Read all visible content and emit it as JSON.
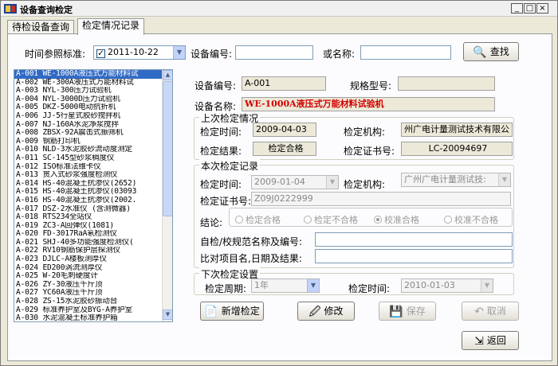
{
  "window": {
    "title": "设备查询检定",
    "min": "_",
    "max": "□",
    "close": "×"
  },
  "tabs": [
    {
      "label": "待检设备查询"
    },
    {
      "label": "检定情况记录"
    }
  ],
  "search": {
    "time_label": "时间参照标准:",
    "date_checked": true,
    "date_value": "2011-10-22",
    "device_no_label": "设备编号:",
    "device_no_value": "",
    "name_label": "或名称:",
    "name_value": "",
    "search_button": "查找"
  },
  "device_list": [
    "A-001 WE-1000A液压式万能材料试",
    "A-002 WE-300A液压式万能材料试",
    "A-003 NYL-300压力试验机",
    "A-004 NYL-3000D压力试验机",
    "A-005 DKZ-5000电动抗折机",
    "A-006 JJ-5行星式胶砂搅拌机",
    "A-007 NJ-160A水泥净浆搅拌",
    "A-008 ZBSX-92A震击式振筛机",
    "A-009 钢筋打印机",
    "A-010 NLD-3水泥胶砂流动度测定",
    "A-011 SC-145型砂浆稠度仪",
    "A-012 ISO标准法维卡仪",
    "A-013 贯入式砂浆强度检测仪",
    "A-014 HS-40混凝土抗渗仪(2652)",
    "A-015 HS-40混凝土抗渗仪(03093",
    "A-016 HS-40混凝土抗渗仪(2002.",
    "A-017 DSZ-2水准仪 (含测微器)",
    "A-018 RTS234全站仪",
    "A-019 ZC3-A回弹仪(1081)",
    "A-020 FD-3017RaA氡检测仪",
    "A-021 SHJ-40多功能强度检测仪(",
    "A-022 RV10钢筋保护层探测仪",
    "A-023 DJLC-A楼板测厚仪",
    "A-024 ED200涡流测厚仪",
    "A-025 W-20毛刺硬度计",
    "A-026 ZY-30液压千斤顶",
    "A-027 YC60A液压千斤顶",
    "A-028 ZS-15水泥胶砂振动台",
    "A-029 标准养护室及BYG-A养护室",
    "A-030 水泥混凝土标准养护箱"
  ],
  "detail": {
    "device_no_label": "设备编号:",
    "device_no_value": "A-001",
    "model_label": "规格型号:",
    "model_value": "",
    "device_name_label": "设备名称:",
    "device_name_value": "WE-1000A液压式万能材料试验机",
    "last": {
      "title": "上次检定情况",
      "date_label": "检定时间:",
      "date_value": "2009-04-03",
      "org_label": "检定机构:",
      "org_value": "州广电计量测试技术有限公",
      "result_label": "检定结果:",
      "result_value": "检定合格",
      "cert_label": "检定证书号:",
      "cert_value": "LC-20094697"
    },
    "current": {
      "title": "本次检定记录",
      "date_label": "检定时间:",
      "date_value": "2009-01-04",
      "org_label": "检定机构:",
      "org_value": "广州广电计量测试技:",
      "cert_label": "检定证书号:",
      "cert_value": "Z09J0222999",
      "conclusion_label": "结论:",
      "options": [
        "检定合格",
        "检定不合格",
        "校准合格",
        "校准不合格"
      ],
      "selected_option": "校准合格",
      "self_check_label": "自检/校规范名称及编号:",
      "self_check_value": "",
      "compare_label": "比对项目名,日期及结果:",
      "compare_value": ""
    },
    "next": {
      "title": "下次检定设置",
      "period_label": "检定周期:",
      "period_value": "1年",
      "date_label": "检定时间:",
      "date_value": "2010-01-03"
    },
    "buttons": {
      "add": "新增检定",
      "edit": "修改",
      "save": "保存",
      "cancel": "取消"
    }
  },
  "return_button": "返回"
}
